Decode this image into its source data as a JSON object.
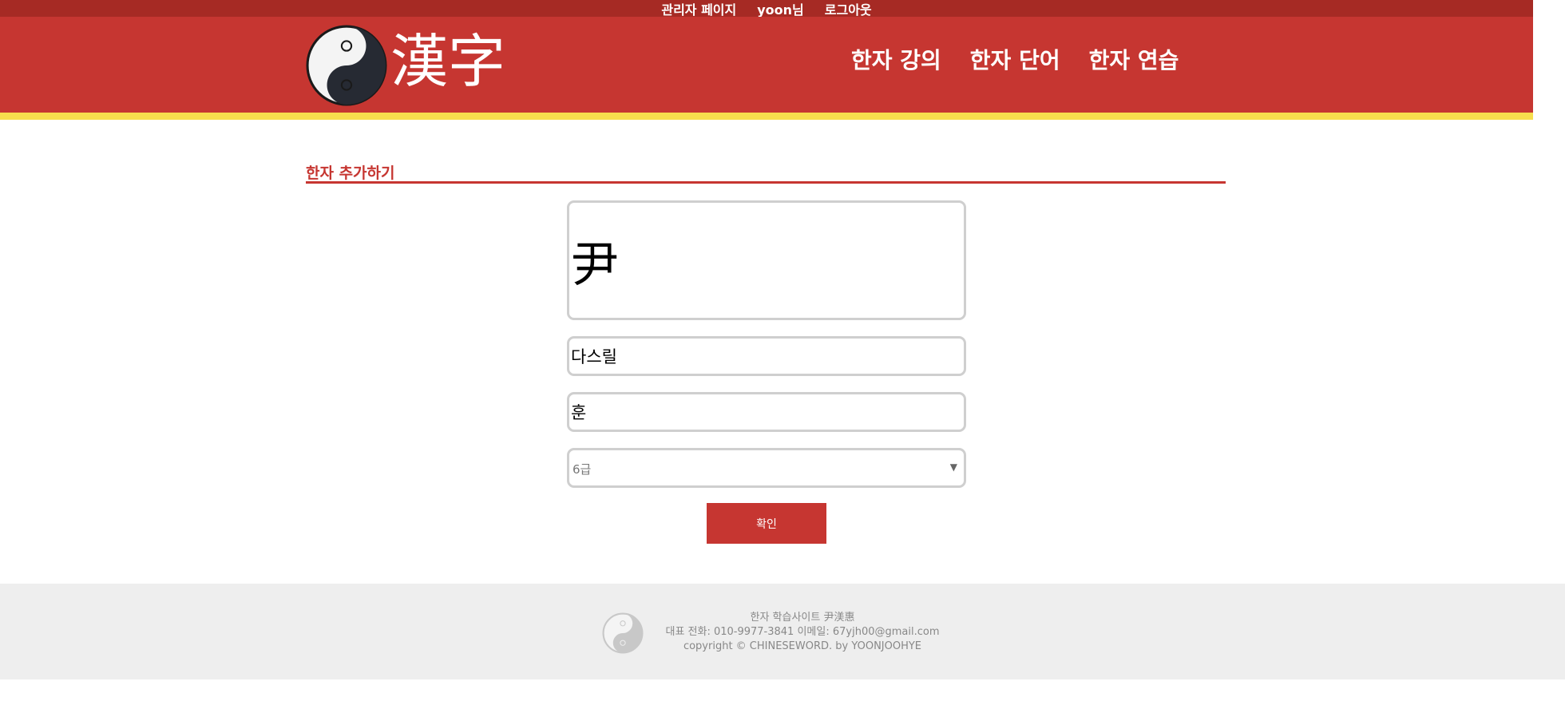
{
  "topbar": {
    "admin_link": "관리자 페이지",
    "user_label": "yoon님",
    "logout_link": "로그아웃"
  },
  "header": {
    "logo_text": "漢字",
    "nav": [
      {
        "label": "한자 강의"
      },
      {
        "label": "한자 단어"
      },
      {
        "label": "한자 연습"
      }
    ]
  },
  "section": {
    "title": "한자 추가하기"
  },
  "form": {
    "hanja_value": "尹",
    "hun_value": "다스릴",
    "eum_value": "훈",
    "level_selected": "6급",
    "submit_label": "확인"
  },
  "footer": {
    "line1": "한자 학습사이트 尹渼惠",
    "line2": "대표 전화: 010-9977-3841 이메일: 67yjh00@gmail.com",
    "line3": "copyright © CHINESEWORD. by YOONJOOHYE"
  },
  "icons": {
    "logo": "yin-yang-icon",
    "footer_logo": "yin-yang-icon",
    "select_arrow": "caret-down-icon"
  },
  "colors": {
    "primary": "#c63631",
    "topbar": "#a62a24",
    "accent": "#f7de4d",
    "footer_bg": "#eeeeee"
  }
}
